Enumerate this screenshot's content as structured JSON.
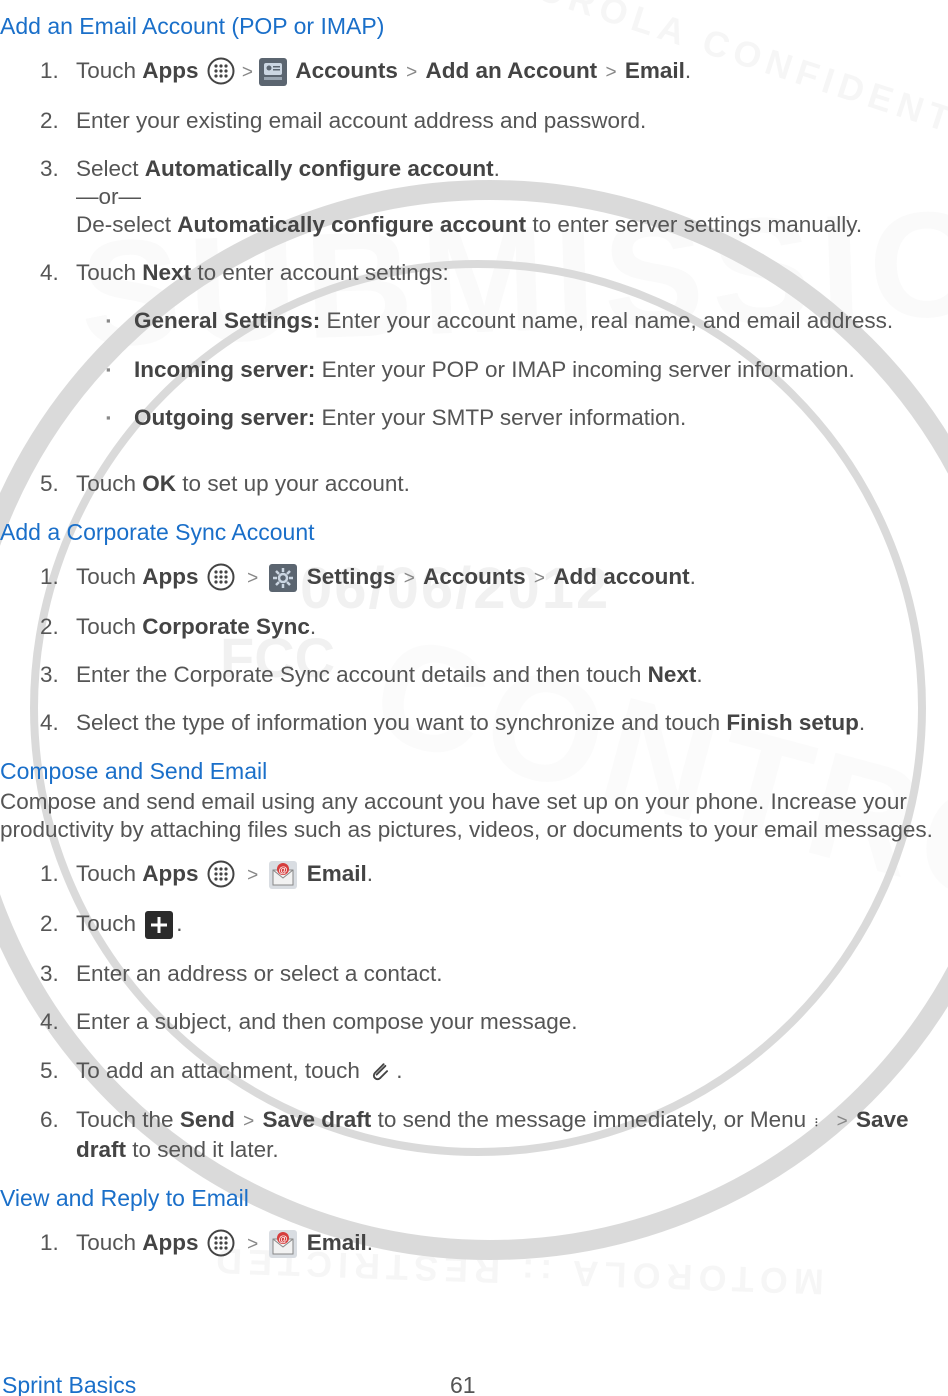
{
  "watermark": {
    "date": "06/06/2012",
    "fcc": "FCC",
    "submission": "SUBMISSION",
    "controlled": "CONTROLLED",
    "arc_top": "MOTOROLA CONFIDENTIAL",
    "arc_bottom": "MOTOROLA :: RESTRICTED"
  },
  "sections": [
    {
      "heading": "Add an Email Account (POP or IMAP)",
      "steps": [
        {
          "n": "1.",
          "pre": "Touch ",
          "b1": "Apps",
          "icon1": "apps",
          "sep1": ">",
          "icon2": "contact-card",
          "b2": " Accounts",
          "sep2": " > ",
          "b3": "Add an Account",
          "sep3": " > ",
          "b4": "Email",
          "post": "."
        },
        {
          "n": "2.",
          "text": "Enter your existing email account address and password."
        },
        {
          "n": "3.",
          "pre": "Select ",
          "b1": "Automatically configure account",
          "post": ".",
          "line2": "—or—",
          "line3_pre": "De-select ",
          "line3_b": "Automatically configure account",
          "line3_post": " to enter server settings manually."
        },
        {
          "n": "4.",
          "pre": "Touch ",
          "b1": "Next",
          "post": " to enter account settings:",
          "subs": [
            {
              "b": "General Settings:",
              "t": " Enter your account name, real name, and email address."
            },
            {
              "b": "Incoming server:",
              "t": " Enter your POP or IMAP incoming server information."
            },
            {
              "b": "Outgoing server:",
              "t": " Enter your SMTP server information."
            }
          ]
        },
        {
          "n": "5.",
          "pre": "Touch ",
          "b1": "OK",
          "post": " to set up your account."
        }
      ]
    },
    {
      "heading": "Add a Corporate Sync Account",
      "steps": [
        {
          "n": "1.",
          "pre": "Touch ",
          "b1": "Apps",
          "icon1": "apps",
          "sep1": " > ",
          "icon2": "settings",
          "b2": " Settings",
          "sep2": " > ",
          "b3": "Accounts",
          "sep3": " > ",
          "b4": "Add account",
          "post": "."
        },
        {
          "n": "2.",
          "pre": "Touch ",
          "b1": "Corporate Sync",
          "post": "."
        },
        {
          "n": "3.",
          "pre": "Enter the Corporate Sync account details and then touch ",
          "b1": "Next",
          "post": "."
        },
        {
          "n": "4.",
          "pre": "Select the type of information you want to synchronize and touch ",
          "b1": "Finish setup",
          "post": "."
        }
      ]
    },
    {
      "heading": "Compose and Send Email",
      "intro": "Compose and send email using any account you have set up on your phone. Increase your productivity by attaching files such as pictures, videos, or documents to your email messages.",
      "steps": [
        {
          "n": "1.",
          "pre": "Touch ",
          "b1": "Apps",
          "icon1": "apps",
          "sep1": " >  ",
          "icon2": "email",
          "b2": " Email",
          "post": "."
        },
        {
          "n": "2.",
          "pre": "Touch ",
          "icon1": "compose",
          "post": "."
        },
        {
          "n": "3.",
          "text": "Enter an address or select a contact."
        },
        {
          "n": "4.",
          "text": "Enter a subject, and then compose your message."
        },
        {
          "n": "5.",
          "pre": "To add an attachment, touch ",
          "icon1": "attach",
          "post": "."
        },
        {
          "n": "6.",
          "pre": "Touch the ",
          "b1": "Send",
          "mid": " to send the message immediately, or Menu ",
          "icon1": "menu",
          "sep1": " > ",
          "b2": "Save draft",
          "post": " to send it later."
        }
      ]
    },
    {
      "heading": "View and Reply to Email",
      "steps": [
        {
          "n": "1.",
          "pre": "Touch ",
          "b1": "Apps",
          "icon1": "apps",
          "sep1": " > ",
          "icon2": "email",
          "b2": " Email",
          "post": "."
        }
      ]
    }
  ],
  "footer": {
    "left": "Sprint Basics",
    "page": "61"
  },
  "icons": {
    "apps": "apps-icon",
    "contact-card": "contact-card-icon",
    "settings": "settings-icon",
    "email": "email-icon",
    "compose": "compose-icon",
    "attach": "attach-icon",
    "menu": "menu-icon"
  }
}
